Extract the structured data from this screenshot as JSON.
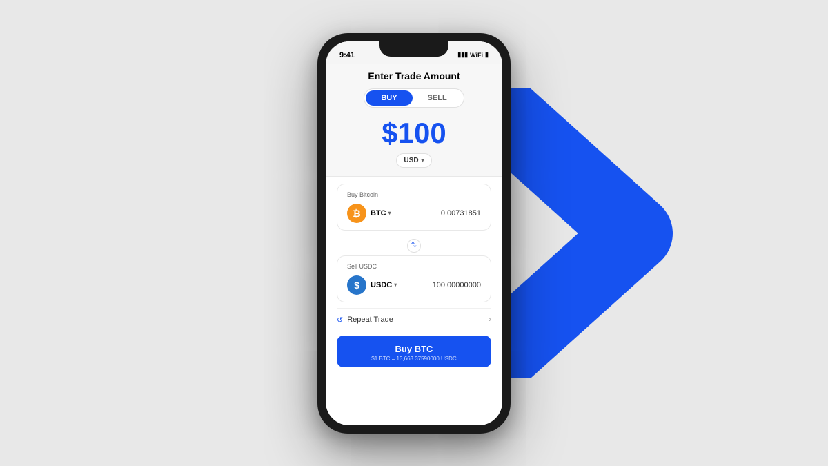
{
  "background": {
    "color": "#e8e8e8"
  },
  "status_bar": {
    "time": "9:41",
    "icons": "●●●"
  },
  "header": {
    "title": "Enter Trade Amount"
  },
  "toggle": {
    "buy_label": "BUY",
    "sell_label": "SELL",
    "active": "buy"
  },
  "amount": {
    "value": "$100",
    "currency": "USD"
  },
  "buy_section": {
    "label": "Buy Bitcoin",
    "coin_name": "BTC",
    "coin_symbol": "₿",
    "amount": "0.00731851"
  },
  "sell_section": {
    "label": "Sell USDC",
    "coin_name": "USDC",
    "coin_symbol": "$",
    "amount": "100.00000000"
  },
  "repeat_trade": {
    "label": "Repeat Trade"
  },
  "buy_button": {
    "main_label": "Buy BTC",
    "sub_label": "$1 BTC = 13,663.37590000 USDC"
  }
}
